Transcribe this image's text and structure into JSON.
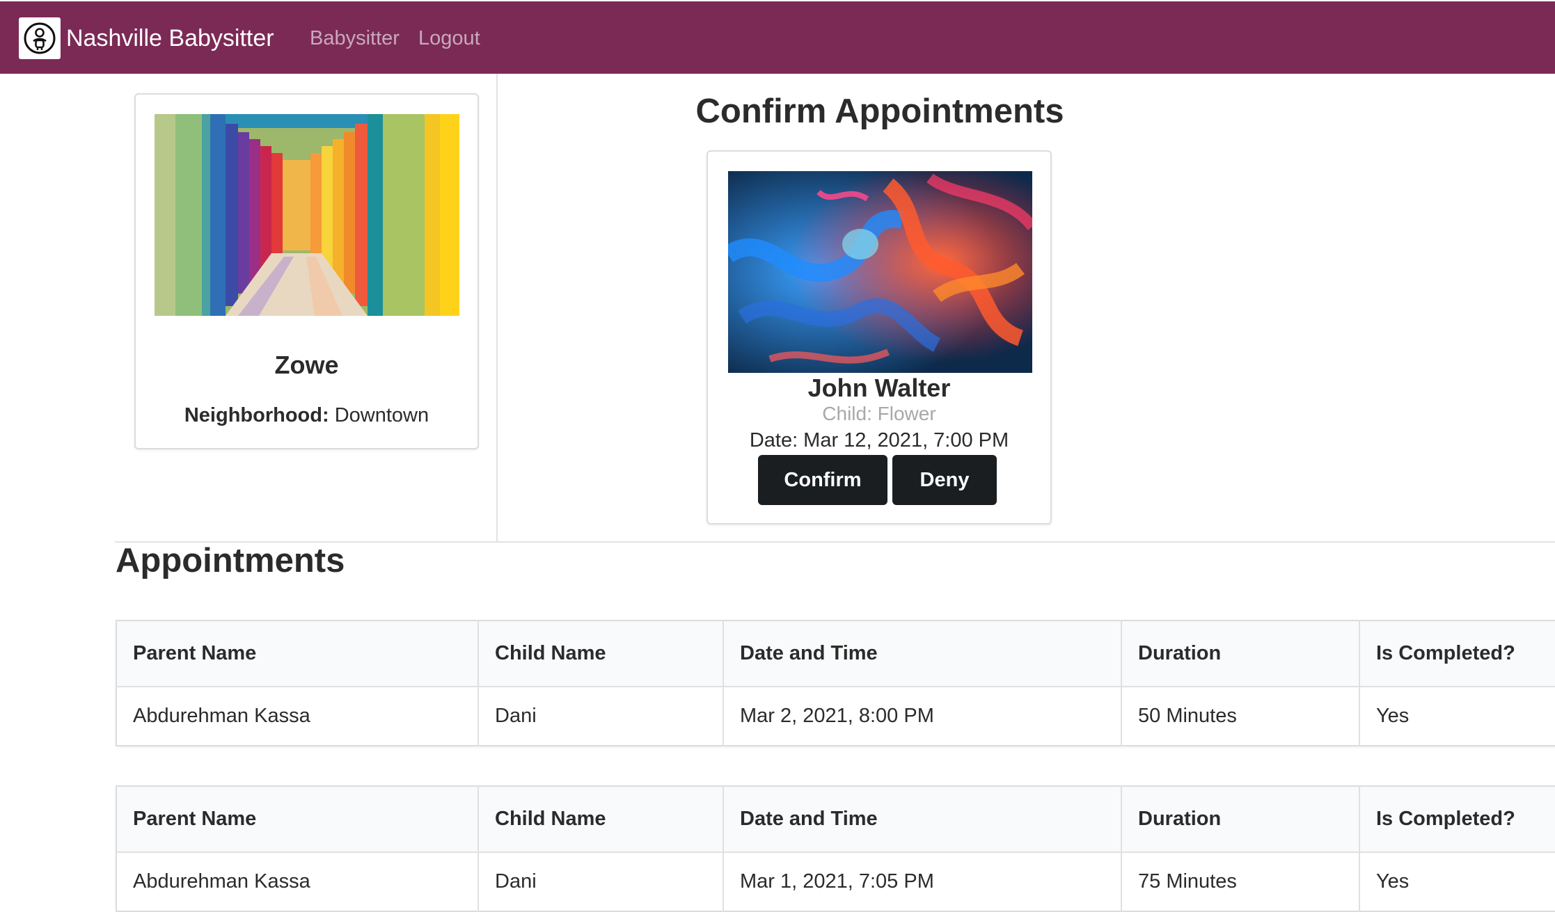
{
  "navbar": {
    "brand": "Nashville Babysitter",
    "logo_icon": "baby-icon",
    "links": [
      "Babysitter",
      "Logout"
    ],
    "background": "#7b2a56"
  },
  "profile": {
    "name": "Zowe",
    "neighborhood_label": "Neighborhood:",
    "neighborhood_value": "Downtown"
  },
  "confirm": {
    "title": "Confirm Appointments",
    "request": {
      "parent_name": "John Walter",
      "child": "Child: Flower",
      "date": "Date: Mar 12, 2021, 7:00 PM",
      "confirm_label": "Confirm",
      "deny_label": "Deny"
    }
  },
  "appointments": {
    "title": "Appointments",
    "columns": [
      "Parent Name",
      "Child Name",
      "Date and Time",
      "Duration",
      "Is Completed?"
    ],
    "rows": [
      [
        "Abdurehman Kassa",
        "Dani",
        "Mar 2, 2021, 8:00 PM",
        "50 Minutes",
        "Yes"
      ],
      [
        "Abdurehman Kassa",
        "Dani",
        "Mar 1, 2021, 7:05 PM",
        "75 Minutes",
        "Yes"
      ]
    ]
  }
}
